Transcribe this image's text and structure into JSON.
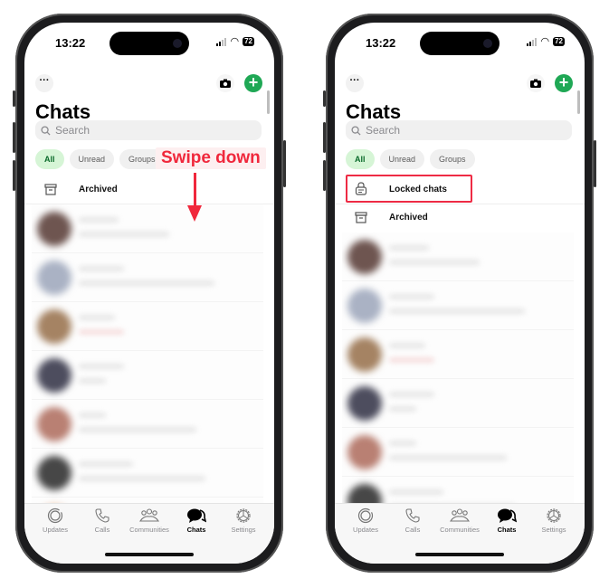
{
  "phones": [
    {
      "status": {
        "time": "13:22",
        "battery": "72"
      },
      "title": "Chats",
      "search_placeholder": "Search",
      "filters": [
        "All",
        "Unread",
        "Groups"
      ],
      "rows": [
        {
          "label": "Archived",
          "icon": "archive-icon"
        }
      ],
      "tabs": [
        "Updates",
        "Calls",
        "Communities",
        "Chats",
        "Settings"
      ],
      "active_tab": "Chats"
    },
    {
      "status": {
        "time": "13:22",
        "battery": "72"
      },
      "title": "Chats",
      "search_placeholder": "Search",
      "filters": [
        "All",
        "Unread",
        "Groups"
      ],
      "rows": [
        {
          "label": "Locked chats",
          "icon": "locked-chat-icon"
        },
        {
          "label": "Archived",
          "icon": "archive-icon"
        }
      ],
      "tabs": [
        "Updates",
        "Calls",
        "Communities",
        "Chats",
        "Settings"
      ],
      "active_tab": "Chats"
    }
  ],
  "annotation": {
    "label": "Swipe down",
    "color": "#f0283c"
  },
  "colors": {
    "accent": "#1fa855",
    "highlight": "#ee2b44"
  }
}
